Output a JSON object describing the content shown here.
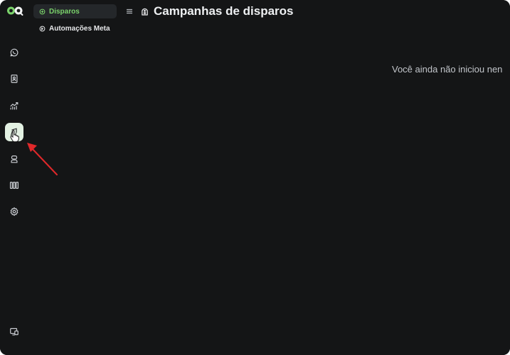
{
  "app": {
    "logo_icon": "double-circle-logo-icon",
    "brand_color": "#7bd36b"
  },
  "rail": {
    "items": [
      {
        "icon": "chat-icon",
        "active": false
      },
      {
        "icon": "contact-book-icon",
        "active": false
      },
      {
        "icon": "trend-chart-icon",
        "active": false
      },
      {
        "icon": "broadcast-icon",
        "active": true
      },
      {
        "icon": "bot-icon",
        "active": false
      },
      {
        "icon": "kanban-columns-icon",
        "active": false
      },
      {
        "icon": "gear-icon",
        "active": false
      },
      {
        "icon": "screen-share-icon",
        "active": false
      }
    ]
  },
  "submenu": {
    "items": [
      {
        "label": "Disparos",
        "icon": "broadcast-icon",
        "active": true
      },
      {
        "label": "Automações Meta",
        "icon": "automation-icon",
        "active": false
      }
    ]
  },
  "header": {
    "title": "Campanhas de disparos",
    "menu_icon": "hamburger-icon",
    "title_icon": "broadcast-icon"
  },
  "main": {
    "empty_message": "Você ainda não iniciou nen"
  },
  "colors": {
    "background": "#141516",
    "active_rail": "#e3f1e3",
    "active_sub_text": "#7bd36b",
    "annotation_arrow": "#e0282a"
  }
}
